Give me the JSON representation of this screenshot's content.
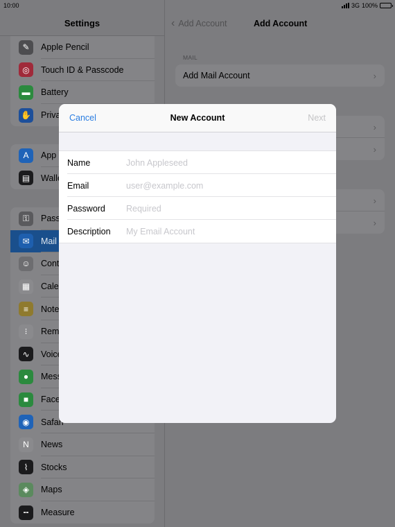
{
  "status": {
    "time": "10:00",
    "network": "3G",
    "battery": "100%"
  },
  "left": {
    "title": "Settings",
    "group1": [
      {
        "label": "Apple Pencil",
        "icon": "pencil-icon",
        "color": "#4d4d50",
        "glyph": "✎"
      },
      {
        "label": "Touch ID & Passcode",
        "icon": "fingerprint-icon",
        "color": "#a02a3a",
        "glyph": "◎"
      },
      {
        "label": "Battery",
        "icon": "battery-icon",
        "color": "#2b8a3e",
        "glyph": "▬"
      },
      {
        "label": "Privacy",
        "icon": "hand-icon",
        "color": "#1d4f9a",
        "glyph": "✋"
      }
    ],
    "group2": [
      {
        "label": "App Store",
        "icon": "app-store-icon",
        "color": "#1f63b8",
        "glyph": "A"
      },
      {
        "label": "Wallet",
        "icon": "wallet-icon",
        "color": "#1b1b1d",
        "glyph": "▤"
      }
    ],
    "group3": [
      {
        "label": "Passwords",
        "icon": "key-icon",
        "color": "#5a5a5d",
        "glyph": "⚿"
      },
      {
        "label": "Mail",
        "icon": "mail-icon",
        "color": "#1e5fae",
        "glyph": "✉",
        "selected": true
      },
      {
        "label": "Contacts",
        "icon": "contacts-icon",
        "color": "#6d6d70",
        "glyph": "☺"
      },
      {
        "label": "Calendar",
        "icon": "calendar-icon",
        "color": "#8a8a8d",
        "glyph": "▦"
      },
      {
        "label": "Notes",
        "icon": "notes-icon",
        "color": "#8f7a2e",
        "glyph": "≡"
      },
      {
        "label": "Reminders",
        "icon": "reminders-icon",
        "color": "#8a8a8d",
        "glyph": "⁝"
      },
      {
        "label": "Voice Memos",
        "icon": "voice-memos-icon",
        "color": "#1b1b1d",
        "glyph": "∿"
      },
      {
        "label": "Messages",
        "icon": "messages-icon",
        "color": "#2b8a3e",
        "glyph": "●"
      },
      {
        "label": "FaceTime",
        "icon": "facetime-icon",
        "color": "#2b8a3e",
        "glyph": "■"
      },
      {
        "label": "Safari",
        "icon": "safari-icon",
        "color": "#1f63b8",
        "glyph": "◉"
      },
      {
        "label": "News",
        "icon": "news-icon",
        "color": "#8a8a8d",
        "glyph": "N"
      },
      {
        "label": "Stocks",
        "icon": "stocks-icon",
        "color": "#1b1b1d",
        "glyph": "⌇"
      },
      {
        "label": "Maps",
        "icon": "maps-icon",
        "color": "#5b8a5e",
        "glyph": "◈"
      },
      {
        "label": "Measure",
        "icon": "measure-icon",
        "color": "#1b1b1d",
        "glyph": "┅"
      }
    ]
  },
  "right": {
    "back_label": "Add Account",
    "title": "Add Account",
    "section_label": "MAIL",
    "add_mail_label": "Add Mail Account"
  },
  "modal": {
    "cancel_label": "Cancel",
    "title": "New Account",
    "next_label": "Next",
    "fields": [
      {
        "label": "Name",
        "placeholder": "John Appleseed"
      },
      {
        "label": "Email",
        "placeholder": "user@example.com"
      },
      {
        "label": "Password",
        "placeholder": "Required"
      },
      {
        "label": "Description",
        "placeholder": "My Email Account"
      }
    ]
  }
}
